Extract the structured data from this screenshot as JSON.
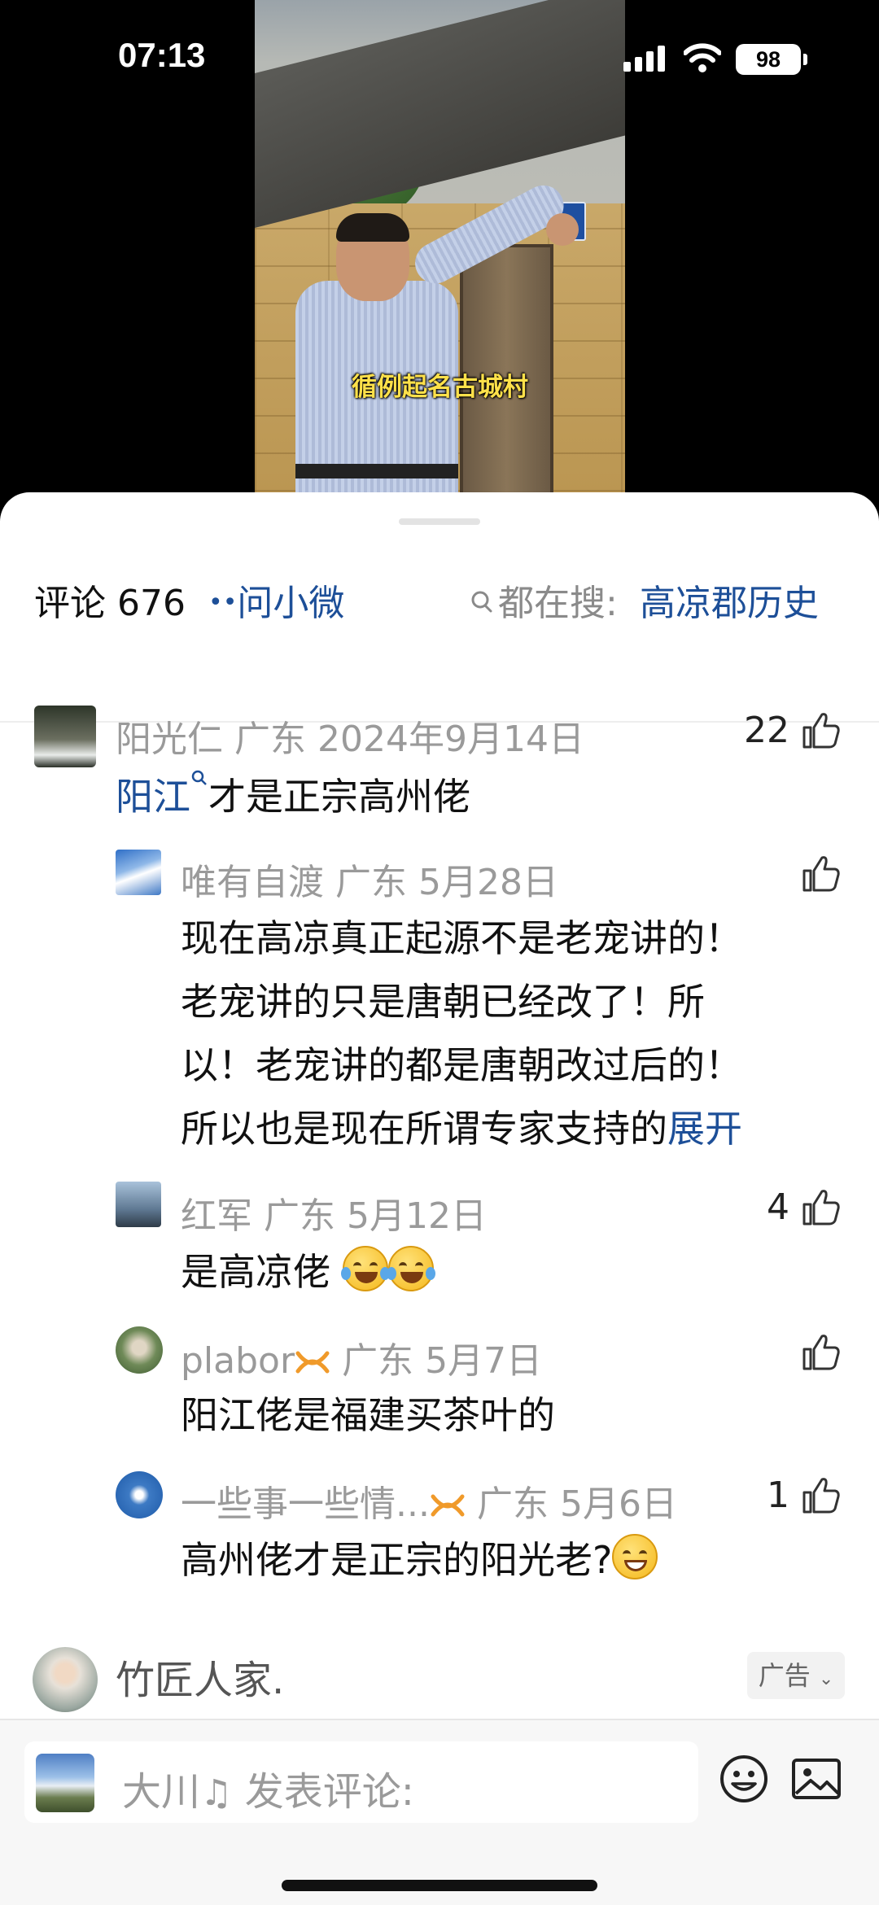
{
  "status_bar": {
    "time": "07:13",
    "battery": "98"
  },
  "video": {
    "subtitle": "循例起名古城村"
  },
  "comments_header": {
    "count_label": "评论 676",
    "ask_dots": "••",
    "ask_label": "问小微",
    "search_prefix": "都在搜:",
    "search_term": "高凉郡历史"
  },
  "comments": [
    {
      "name": "阳光仁",
      "location": "广东",
      "date": "2024年9月14日",
      "likes": "22",
      "text_link": "阳江",
      "text": "才是正宗高州佬",
      "replies": [
        {
          "name": "唯有自渡",
          "location": "广东",
          "date": "5月28日",
          "likes": "",
          "lines": [
            "现在高凉真正起源不是老宠讲的！",
            "老宠讲的只是唐朝已经改了！所",
            "以！老宠讲的都是唐朝改过后的！",
            "所以也是现在所谓专家支持的"
          ],
          "expand": "展开"
        },
        {
          "name": "红军",
          "location": "广东",
          "date": "5月12日",
          "likes": "4",
          "text": "是高凉佬"
        },
        {
          "name": "plabor",
          "location": "广东",
          "date": "5月7日",
          "likes": "",
          "text": "阳江佬是福建买茶叶的"
        },
        {
          "name": "一些事一些情...",
          "location": "广东",
          "date": "5月6日",
          "likes": "1",
          "text": "高州佬才是正宗的阳光老?"
        }
      ]
    }
  ],
  "ad": {
    "name": "竹匠人家.",
    "tag": "广告"
  },
  "bottom_bar": {
    "placeholder_name": "大川",
    "placeholder_text": "发表评论:"
  },
  "colors": {
    "link": "#1d4f98",
    "meta": "#9a9a9a",
    "badge": "#f09a2a"
  }
}
